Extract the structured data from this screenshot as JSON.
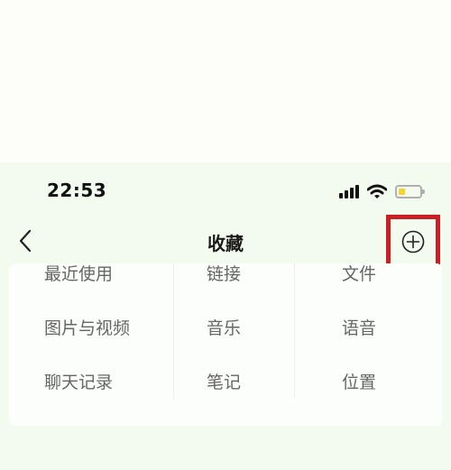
{
  "status_bar": {
    "time": "22:53",
    "battery_level": 0.3,
    "battery_color": "#f6d330"
  },
  "nav": {
    "back_icon": "chevron-left-icon",
    "title": "收藏",
    "add_icon": "plus-circle-icon",
    "highlight_color": "#cc1f25"
  },
  "categories": [
    {
      "label": "最近使用"
    },
    {
      "label": "链接"
    },
    {
      "label": "文件"
    },
    {
      "label": "图片与视频"
    },
    {
      "label": "音乐"
    },
    {
      "label": "语音"
    },
    {
      "label": "聊天记录"
    },
    {
      "label": "笔记"
    },
    {
      "label": "位置"
    }
  ]
}
